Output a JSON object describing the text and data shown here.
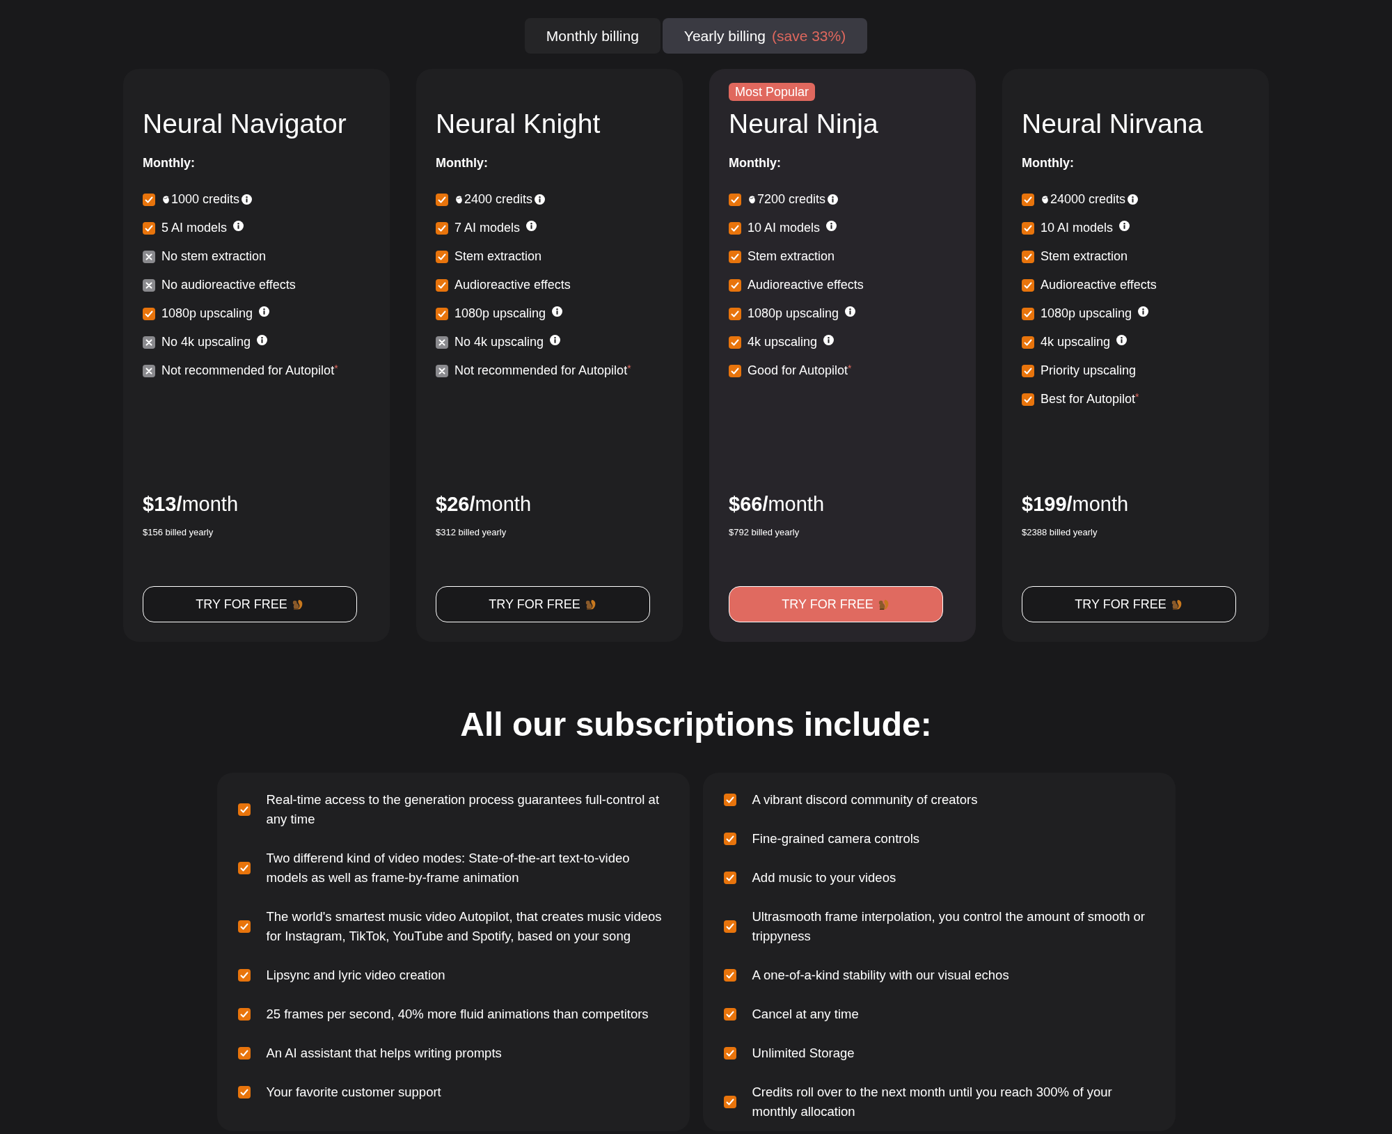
{
  "billing_toggle": [
    {
      "label": "Monthly billing",
      "selected": false
    },
    {
      "label": "Yearly billing",
      "note": "(save 33%)",
      "selected": true
    }
  ],
  "plans": [
    {
      "name": "Neural Navigator",
      "popular": false,
      "period_label": "Monthly:",
      "features": [
        {
          "text": "1000 credits",
          "included": true,
          "credits": true,
          "info": true
        },
        {
          "text": "5 AI models",
          "included": true,
          "info": true
        },
        {
          "text": "No stem extraction",
          "included": false
        },
        {
          "text": "No audioreactive effects",
          "included": false
        },
        {
          "text": "1080p upscaling",
          "included": true,
          "info": true
        },
        {
          "text": "No 4k upscaling",
          "included": false,
          "info": true
        },
        {
          "text": "Not recommended for Autopilot",
          "included": false,
          "footnote": "*"
        }
      ],
      "price": "**$13/**month",
      "billed": "$156 billed yearly",
      "cta": "TRY FOR FREE"
    },
    {
      "name": "Neural Knight",
      "popular": false,
      "period_label": "Monthly:",
      "features": [
        {
          "text": "2400 credits",
          "included": true,
          "credits": true,
          "info": true
        },
        {
          "text": "7 AI models",
          "included": true,
          "info": true
        },
        {
          "text": "Stem extraction",
          "included": true
        },
        {
          "text": "Audioreactive effects",
          "included": true
        },
        {
          "text": "1080p upscaling",
          "included": true,
          "info": true
        },
        {
          "text": "No 4k upscaling",
          "included": false,
          "info": true
        },
        {
          "text": "Not recommended for Autopilot",
          "included": false,
          "footnote": "*"
        }
      ],
      "price": "**$26/**month",
      "billed": "$312 billed yearly",
      "cta": "TRY FOR FREE"
    },
    {
      "name": "Neural Ninja",
      "popular": true,
      "badge": "Most Popular",
      "period_label": "Monthly:",
      "features": [
        {
          "text": "7200 credits",
          "included": true,
          "credits": true,
          "info": true
        },
        {
          "text": "10 AI models",
          "included": true,
          "info": true
        },
        {
          "text": "Stem extraction",
          "included": true
        },
        {
          "text": "Audioreactive effects",
          "included": true
        },
        {
          "text": "1080p upscaling",
          "included": true,
          "info": true
        },
        {
          "text": "4k upscaling",
          "included": true,
          "info": true
        },
        {
          "text": "Good for Autopilot",
          "included": true,
          "footnote": "*"
        }
      ],
      "price": "**$66/**month",
      "billed": "$792 billed yearly",
      "cta": "TRY FOR FREE"
    },
    {
      "name": "Neural Nirvana",
      "popular": false,
      "period_label": "Monthly:",
      "features": [
        {
          "text": "24000 credits",
          "included": true,
          "credits": true,
          "info": true
        },
        {
          "text": "10 AI models",
          "included": true,
          "info": true
        },
        {
          "text": "Stem extraction",
          "included": true
        },
        {
          "text": "Audioreactive effects",
          "included": true
        },
        {
          "text": "1080p upscaling",
          "included": true,
          "info": true
        },
        {
          "text": "4k upscaling",
          "included": true,
          "info": true
        },
        {
          "text": "Priority upscaling",
          "included": true
        },
        {
          "text": "Best for Autopilot",
          "included": true,
          "footnote": "*"
        }
      ],
      "price": "**$199/**month",
      "billed": "$2388 billed yearly",
      "cta": "TRY FOR FREE"
    }
  ],
  "included_heading": "All our subscriptions include:",
  "included_columns": [
    [
      "Real-time access to the generation process guarantees full-control at any time",
      "Two differend kind of video modes: State-of-the-art text-to-video models as well as frame-by-frame animation",
      "The world's smartest music video Autopilot, that creates music videos for Instagram, TikTok, YouTube and Spotify, based on your song",
      "Lipsync and lyric video creation",
      "25 frames per second, 40% more fluid animations than competitors",
      "An AI assistant that helps writing prompts",
      "Your favorite customer support"
    ],
    [
      "A vibrant discord community of creators",
      "Fine-grained camera controls",
      "Add music to your videos",
      "Ultrasmooth frame interpolation, you control the amount of smooth or trippyness",
      "A one-of-a-kind stability with our visual echos",
      "Cancel at any time",
      "Unlimited Storage",
      "Credits roll over to the next month until you reach 300% of your monthly allocation"
    ]
  ]
}
